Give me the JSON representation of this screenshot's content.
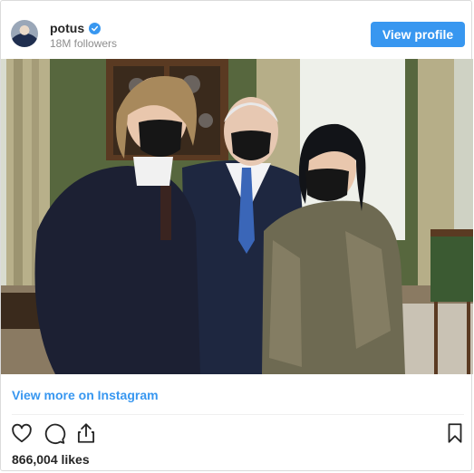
{
  "post": {
    "username": "potus",
    "followers": "18M followers",
    "view_profile_label": "View profile",
    "view_more_label": "View more on Instagram",
    "likes": "866,004 likes"
  },
  "colors": {
    "accent": "#3897f0",
    "text": "#262626",
    "muted": "#8e8e8e"
  },
  "icons": [
    "verified-badge-icon",
    "heart-icon",
    "comment-icon",
    "share-icon",
    "bookmark-icon"
  ]
}
